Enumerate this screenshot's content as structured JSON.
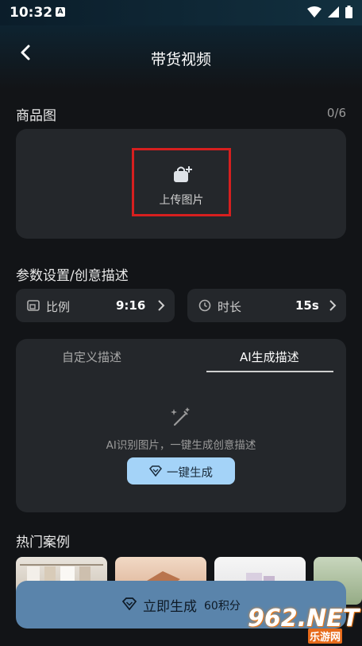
{
  "status": {
    "time": "10:32",
    "badge": "A"
  },
  "header": {
    "title": "带货视频"
  },
  "product": {
    "section_title": "商品图",
    "counter": "0/6",
    "upload_label": "上传图片"
  },
  "params": {
    "section_title": "参数设置/创意描述",
    "ratio": {
      "label": "比例",
      "value": "9:16"
    },
    "duration": {
      "label": "时长",
      "value": "15s"
    }
  },
  "desc": {
    "tabs": [
      "自定义描述",
      "AI生成描述"
    ],
    "active_tab": "AI生成描述",
    "hint": "AI识别图片，一键生成创意描述",
    "generate_label": "一键生成"
  },
  "cases": {
    "section_title": "热门案例"
  },
  "submit": {
    "label": "立即生成",
    "points": "60积分"
  },
  "watermark": {
    "brand": "962.NET",
    "sub": "乐游网"
  },
  "colors": {
    "accent_button": "#a4d3f8",
    "submit_bg": "#5a84ab",
    "highlight_box": "#d61f1f",
    "background": "#121417",
    "card": "#24272b"
  }
}
